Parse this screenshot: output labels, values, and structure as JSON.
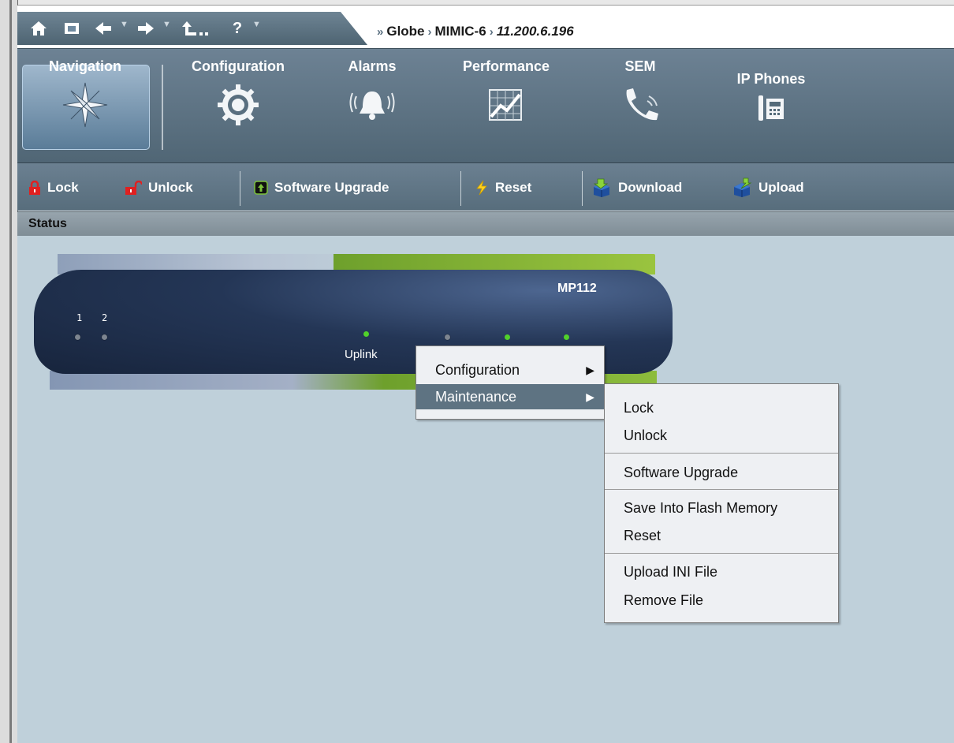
{
  "breadcrumb": {
    "items": [
      "Globe",
      "MIMIC-6",
      "11.200.6.196"
    ]
  },
  "address_toolbar": {
    "icons": [
      "home-icon",
      "folder-icon",
      "back-arrow-icon",
      "forward-arrow-icon",
      "up-level-icon",
      "help-icon"
    ]
  },
  "ribbon": {
    "tabs": [
      {
        "label": "Navigation",
        "icon": "compass-star-icon",
        "active": true
      },
      {
        "label": "Configuration",
        "icon": "gear-icon"
      },
      {
        "label": "Alarms",
        "icon": "bell-icon"
      },
      {
        "label": "Performance",
        "icon": "chart-icon"
      },
      {
        "label": "SEM",
        "icon": "phone-handset-icon"
      },
      {
        "label": "IP Phones",
        "icon": "desk-phone-icon"
      }
    ]
  },
  "toolbar": {
    "buttons": [
      {
        "label": "Lock",
        "icon": "lock-icon"
      },
      {
        "label": "Unlock",
        "icon": "unlock-icon"
      },
      {
        "label": "Software Upgrade",
        "icon": "upgrade-icon"
      },
      {
        "label": "Reset",
        "icon": "lightning-icon"
      },
      {
        "label": "Download",
        "icon": "download-box-icon"
      },
      {
        "label": "Upload",
        "icon": "upload-box-icon"
      }
    ]
  },
  "status": {
    "label": "Status"
  },
  "device": {
    "model": "MP112",
    "port1": "1",
    "port2": "2",
    "uplink_label": "Uplink"
  },
  "context_menu": {
    "items": [
      {
        "label": "Configuration",
        "submenu": true
      },
      {
        "label": "Maintenance",
        "submenu": true,
        "active": true
      }
    ]
  },
  "maintenance_submenu": {
    "groups": [
      [
        "Lock",
        "Unlock"
      ],
      [
        "Software Upgrade"
      ],
      [
        "Save Into Flash Memory",
        "Reset"
      ],
      [
        "Upload INI File",
        "Remove File"
      ]
    ]
  },
  "colors": {
    "ribbon": "#5e7382",
    "content_bg": "#bfd0da",
    "menu_active": "#5e7382",
    "device_green": "#8cbc3c"
  }
}
